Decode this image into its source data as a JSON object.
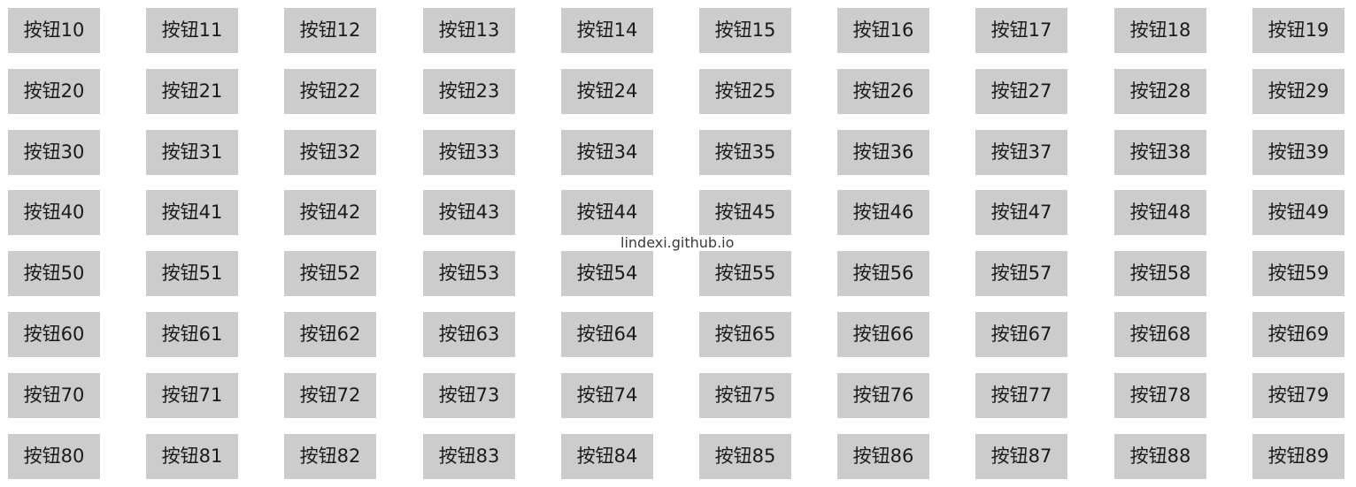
{
  "buttons": [
    "按钮10",
    "按钮11",
    "按钮12",
    "按钮13",
    "按钮14",
    "按钮15",
    "按钮16",
    "按钮17",
    "按钮18",
    "按钮19",
    "按钮20",
    "按钮21",
    "按钮22",
    "按钮23",
    "按钮24",
    "按钮25",
    "按钮26",
    "按钮27",
    "按钮28",
    "按钮29",
    "按钮30",
    "按钮31",
    "按钮32",
    "按钮33",
    "按钮34",
    "按钮35",
    "按钮36",
    "按钮37",
    "按钮38",
    "按钮39",
    "按钮40",
    "按钮41",
    "按钮42",
    "按钮43",
    "按钮44",
    "按钮45",
    "按钮46",
    "按钮47",
    "按钮48",
    "按钮49",
    "按钮50",
    "按钮51",
    "按钮52",
    "按钮53",
    "按钮54",
    "按钮55",
    "按钮56",
    "按钮57",
    "按钮58",
    "按钮59",
    "按钮60",
    "按钮61",
    "按钮62",
    "按钮63",
    "按钮64",
    "按钮65",
    "按钮66",
    "按钮67",
    "按钮68",
    "按钮69",
    "按钮70",
    "按钮71",
    "按钮72",
    "按钮73",
    "按钮74",
    "按钮75",
    "按钮76",
    "按钮77",
    "按钮78",
    "按钮79",
    "按钮80",
    "按钮81",
    "按钮82",
    "按钮83",
    "按钮84",
    "按钮85",
    "按钮86",
    "按钮87",
    "按钮88",
    "按钮89"
  ],
  "watermark": "lindexi.github.io",
  "colors": {
    "button_background": "#cccccc",
    "button_text": "#1a1a1a",
    "page_background": "#ffffff"
  }
}
